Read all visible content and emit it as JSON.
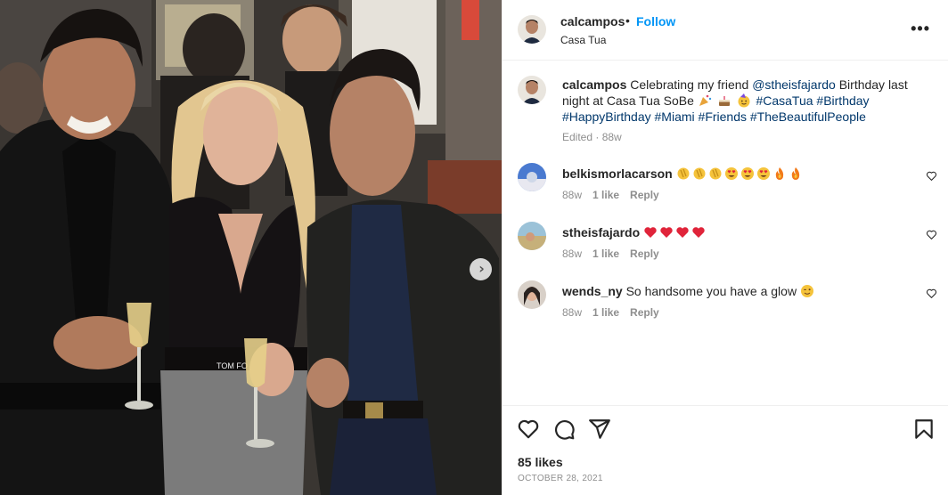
{
  "post": {
    "author": "calcampos",
    "separator": "•",
    "follow_label": "Follow",
    "location": "Casa Tua",
    "more_label": "•••",
    "next_label": "›"
  },
  "caption": {
    "author": "calcampos",
    "text1": " Celebrating my friend ",
    "mention": "@stheisfajardo",
    "text2": " Birthday last night at Casa Tua SoBe ",
    "hashtags": [
      "#CasaTua",
      "#Birthday",
      "#HappyBirthday",
      "#Miami",
      "#Friends",
      "#TheBeautifulPeople"
    ],
    "meta": "Edited · 88w"
  },
  "comments": [
    {
      "user": "belkismorlacarson",
      "text": "",
      "emojis": [
        "clap",
        "clap",
        "clap",
        "heart-eyes",
        "heart-eyes",
        "heart-eyes",
        "fire",
        "fire"
      ],
      "age": "88w",
      "likes": "1 like",
      "reply": "Reply"
    },
    {
      "user": "stheisfajardo",
      "text": "",
      "emojis": [
        "red-heart",
        "red-heart",
        "red-heart",
        "red-heart"
      ],
      "age": "88w",
      "likes": "1 like",
      "reply": "Reply"
    },
    {
      "user": "wends_ny",
      "text": "So handsome you have a glow",
      "emojis": [
        "wink"
      ],
      "age": "88w",
      "likes": "1 like",
      "reply": "Reply"
    }
  ],
  "footer": {
    "likes": "85 likes",
    "date": "OCTOBER 28, 2021"
  },
  "icons": {
    "more": "more-options-icon",
    "like": "heart-icon",
    "comment": "comment-icon",
    "share": "share-icon",
    "save": "bookmark-icon"
  },
  "colors": {
    "link": "#0095f6",
    "hashtag": "#00376b",
    "muted": "#8e8e8e",
    "text": "#262626"
  }
}
